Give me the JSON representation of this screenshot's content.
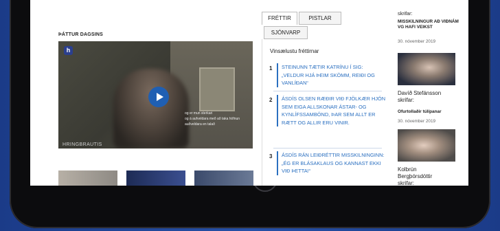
{
  "section": {
    "label": "ÞÁTTUR DAGSINS"
  },
  "video": {
    "brand": "HRINGBRAUTIS",
    "badge": "h",
    "caption_line1": "og er mun sterkari",
    "caption_line2": "og á aufveldara með að taka höfnun",
    "caption_line3": "auðveldara en talað"
  },
  "tabs": [
    {
      "label": "FRÉTTIR"
    },
    {
      "label": "PISTLAR"
    },
    {
      "label": "SJÓNVARP"
    }
  ],
  "news": {
    "title": "Vinsælustu fréttirnar",
    "items": [
      {
        "num": "1",
        "text": "STEINUNN TÆTIR KATRÍNU Í SIG: „VELDUR HJÁ ÞEIM SKÖMM, REIÐI OG VANLÍÐAN“"
      },
      {
        "num": "2",
        "text": "ÁSDÍS OLSEN RÆÐIR VIÐ FJÖLKÆR HJÓN SEM EIGA ALLSKONAR ÁSTAR- OG KYNLÍFSSAMBÖND, ÞAR SEM ALLT ER RÆTT OG ALLIR ERU VINIR."
      },
      {
        "num": "3",
        "text": "ÁSDÍS RÁN LEIÐRÉTTIR MISSKILNINGINN: „ÉG ER BLÁSAKLAUS OG KANNAST EKKI VIÐ ÞETTA!“"
      }
    ]
  },
  "columns": {
    "top_writes": "skrifar:",
    "top_headline": "MISSKILNINGUR AÐ VIÐNÁM VG HAFI VEIKST",
    "top_date": "30. nóvember 2019",
    "item1_author": "Davíð Stefánsson",
    "item1_writes": "skrifar:",
    "item1_headline": "Ofurtollaðir túlípanar",
    "item1_date": "30. nóvember 2019",
    "item2_author1": "Kolbrún",
    "item2_author2": "Bergþórsdóttir",
    "item2_writes": "skrifar:"
  }
}
